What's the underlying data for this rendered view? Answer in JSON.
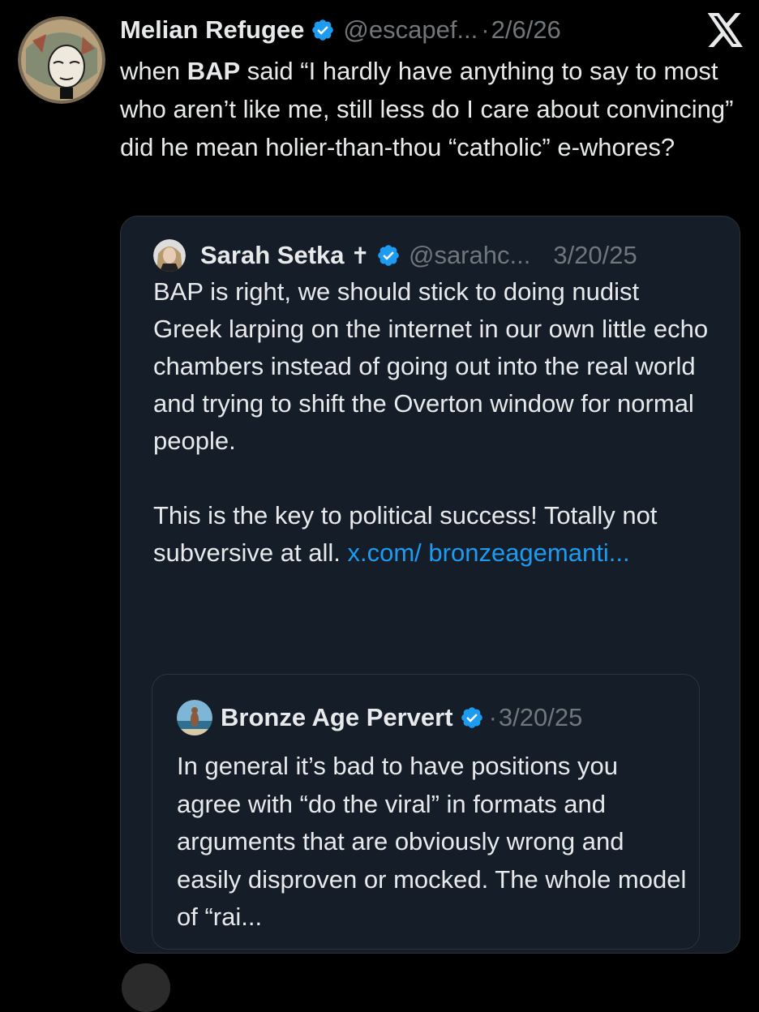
{
  "tweet": {
    "author_name": "Melian Refugee",
    "handle": "@escapef...",
    "separator": "·",
    "date": "2/6/26",
    "text_prefix": "when ",
    "text_bold": "BAP",
    "text_rest": " said “I hardly have anything to say to most who aren’t like me, still less do I care about convincing” did he mean holier-than-thou “catholic” e-whores?",
    "verified_color": "#1d9bf0"
  },
  "quote": {
    "author_name": "Sarah Setka",
    "emoji": "✝",
    "handle": "@sarahc...",
    "date": "3/20/25",
    "paragraph1": "BAP is right, we should stick to doing nudist Greek larping on the internet in our own little echo chambers instead of going out into the real world and trying to shift the Overton window for normal people.",
    "paragraph2": "This is the key to political success! Totally not subversive at all. ",
    "link_text": "x.com/ bronzeagemanti..."
  },
  "nested_quote": {
    "author_name": "Bronze Age Pervert",
    "separator": "·",
    "date": "3/20/25",
    "text": "In general it’s bad to have positions you agree with “do the viral” in formats and arguments that are obviously wrong and easily disproven or mocked. The whole model of “rai..."
  },
  "icons": [
    "verified-badge-icon",
    "x-logo-icon"
  ]
}
